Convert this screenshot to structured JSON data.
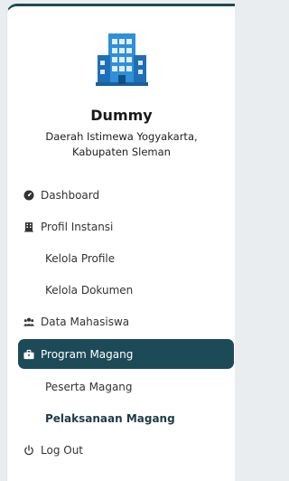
{
  "org": {
    "name": "Dummy",
    "address_line1": "Daerah Istimewa Yogyakarta,",
    "address_line2": "Kabupaten Sleman",
    "logo_icon": "building-icon"
  },
  "menu": [
    {
      "label": "Dashboard",
      "icon": "dashboard-icon"
    },
    {
      "label": "Profil Instansi",
      "icon": "building-small-icon"
    },
    {
      "label": "Kelola Profile"
    },
    {
      "label": "Kelola Dokumen"
    },
    {
      "label": "Data Mahasiswa",
      "icon": "users-icon"
    },
    {
      "label": "Program Magang",
      "icon": "briefcase-icon",
      "active": true
    },
    {
      "label": "Peserta Magang"
    },
    {
      "label": "Pelaksanaan Magang"
    },
    {
      "label": "Log Out",
      "icon": "power-icon"
    }
  ],
  "colors": {
    "accent": "#1d4a57",
    "logo_blue": "#2f8fd8"
  }
}
